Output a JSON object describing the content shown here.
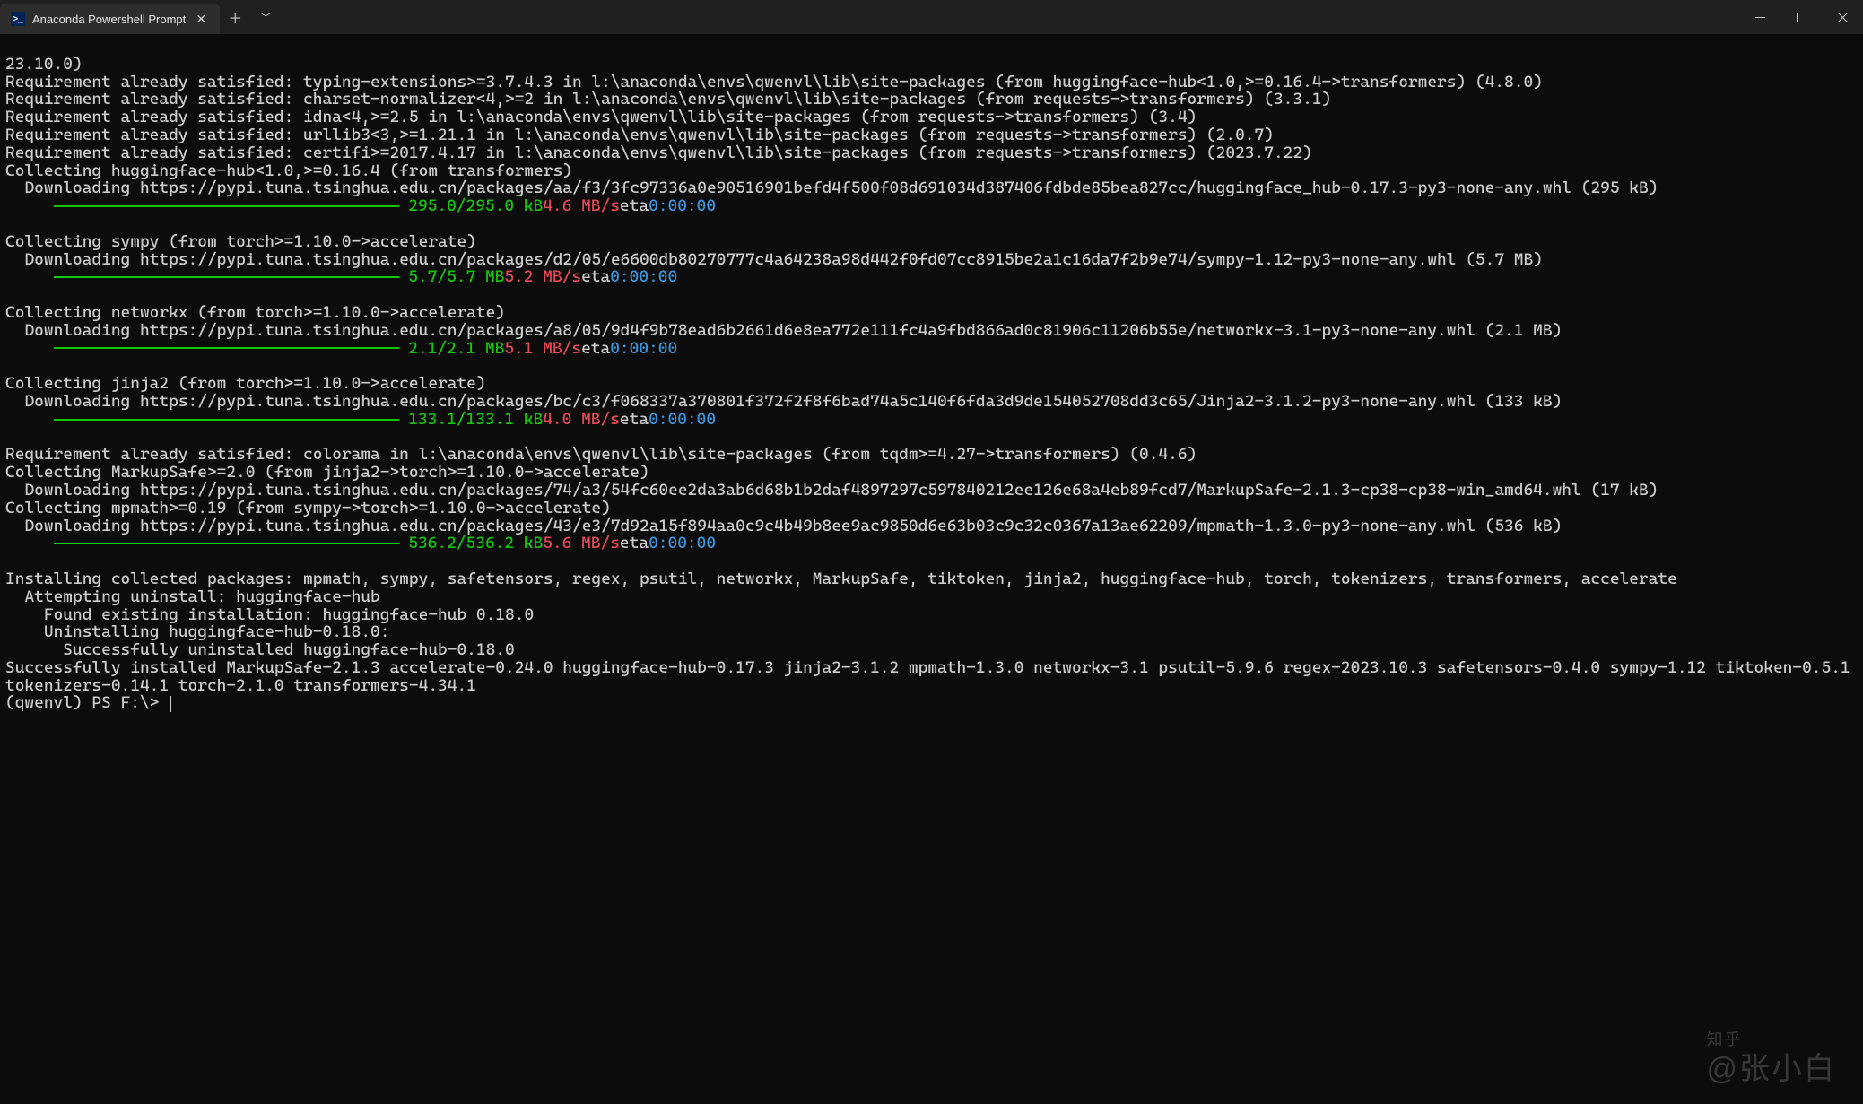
{
  "titlebar": {
    "tab_title": "Anaconda Powershell Prompt",
    "tab_icon_text": ">_"
  },
  "progress": [
    {
      "size": "295.0/295.0 kB",
      "speed": "4.6 MB/s",
      "eta_label": "eta",
      "eta": "0:00:00"
    },
    {
      "size": "5.7/5.7 MB",
      "speed": "5.2 MB/s",
      "eta_label": "eta",
      "eta": "0:00:00"
    },
    {
      "size": "2.1/2.1 MB",
      "speed": "5.1 MB/s",
      "eta_label": "eta",
      "eta": "0:00:00"
    },
    {
      "size": "133.1/133.1 kB",
      "speed": "4.0 MB/s",
      "eta_label": "eta",
      "eta": "0:00:00"
    },
    {
      "size": "536.2/536.2 kB",
      "speed": "5.6 MB/s",
      "eta_label": "eta",
      "eta": "0:00:00"
    }
  ],
  "lines": {
    "l1": "23.10.0)",
    "l2": "Requirement already satisfied: typing-extensions>=3.7.4.3 in l:\\anaconda\\envs\\qwenvl\\lib\\site-packages (from huggingface-hub<1.0,>=0.16.4->transformers) (4.8.0)",
    "l3": "Requirement already satisfied: charset-normalizer<4,>=2 in l:\\anaconda\\envs\\qwenvl\\lib\\site-packages (from requests->transformers) (3.3.1)",
    "l4": "Requirement already satisfied: idna<4,>=2.5 in l:\\anaconda\\envs\\qwenvl\\lib\\site-packages (from requests->transformers) (3.4)",
    "l5": "Requirement already satisfied: urllib3<3,>=1.21.1 in l:\\anaconda\\envs\\qwenvl\\lib\\site-packages (from requests->transformers) (2.0.7)",
    "l6": "Requirement already satisfied: certifi>=2017.4.17 in l:\\anaconda\\envs\\qwenvl\\lib\\site-packages (from requests->transformers) (2023.7.22)",
    "l7": "Collecting huggingface-hub<1.0,>=0.16.4 (from transformers)",
    "l8": "  Downloading https://pypi.tuna.tsinghua.edu.cn/packages/aa/f3/3fc97336a0e90516901befd4f500f08d691034d387406fdbde85bea827cc/huggingface_hub-0.17.3-py3-none-any.whl (295 kB)",
    "l9": "Collecting sympy (from torch>=1.10.0->accelerate)",
    "l10": "  Downloading https://pypi.tuna.tsinghua.edu.cn/packages/d2/05/e6600db80270777c4a64238a98d442f0fd07cc8915be2a1c16da7f2b9e74/sympy-1.12-py3-none-any.whl (5.7 MB)",
    "l11": "Collecting networkx (from torch>=1.10.0->accelerate)",
    "l12": "  Downloading https://pypi.tuna.tsinghua.edu.cn/packages/a8/05/9d4f9b78ead6b2661d6e8ea772e111fc4a9fbd866ad0c81906c11206b55e/networkx-3.1-py3-none-any.whl (2.1 MB)",
    "l13": "Collecting jinja2 (from torch>=1.10.0->accelerate)",
    "l14": "  Downloading https://pypi.tuna.tsinghua.edu.cn/packages/bc/c3/f068337a370801f372f2f8f6bad74a5c140f6fda3d9de154052708dd3c65/Jinja2-3.1.2-py3-none-any.whl (133 kB)",
    "l15": "Requirement already satisfied: colorama in l:\\anaconda\\envs\\qwenvl\\lib\\site-packages (from tqdm>=4.27->transformers) (0.4.6)",
    "l16": "Collecting MarkupSafe>=2.0 (from jinja2->torch>=1.10.0->accelerate)",
    "l17": "  Downloading https://pypi.tuna.tsinghua.edu.cn/packages/74/a3/54fc60ee2da3ab6d68b1b2daf4897297c597840212ee126e68a4eb89fcd7/MarkupSafe-2.1.3-cp38-cp38-win_amd64.whl (17 kB)",
    "l18": "Collecting mpmath>=0.19 (from sympy->torch>=1.10.0->accelerate)",
    "l19": "  Downloading https://pypi.tuna.tsinghua.edu.cn/packages/43/e3/7d92a15f894aa0c9c4b49b8ee9ac9850d6e63b03c9c32c0367a13ae62209/mpmath-1.3.0-py3-none-any.whl (536 kB)",
    "l20": "Installing collected packages: mpmath, sympy, safetensors, regex, psutil, networkx, MarkupSafe, tiktoken, jinja2, huggingface-hub, torch, tokenizers, transformers, accelerate",
    "l21": "  Attempting uninstall: huggingface-hub",
    "l22": "    Found existing installation: huggingface-hub 0.18.0",
    "l23": "    Uninstalling huggingface-hub-0.18.0:",
    "l24": "      Successfully uninstalled huggingface-hub-0.18.0",
    "l25": "Successfully installed MarkupSafe-2.1.3 accelerate-0.24.0 huggingface-hub-0.17.3 jinja2-3.1.2 mpmath-1.3.0 networkx-3.1 psutil-5.9.6 regex-2023.10.3 safetensors-0.4.0 sympy-1.12 tiktoken-0.5.1 tokenizers-0.14.1 torch-2.1.0 transformers-4.34.1",
    "prompt": "(qwenvl) PS F:\\> "
  },
  "watermark": {
    "site": "知乎",
    "author": "@张小白"
  }
}
